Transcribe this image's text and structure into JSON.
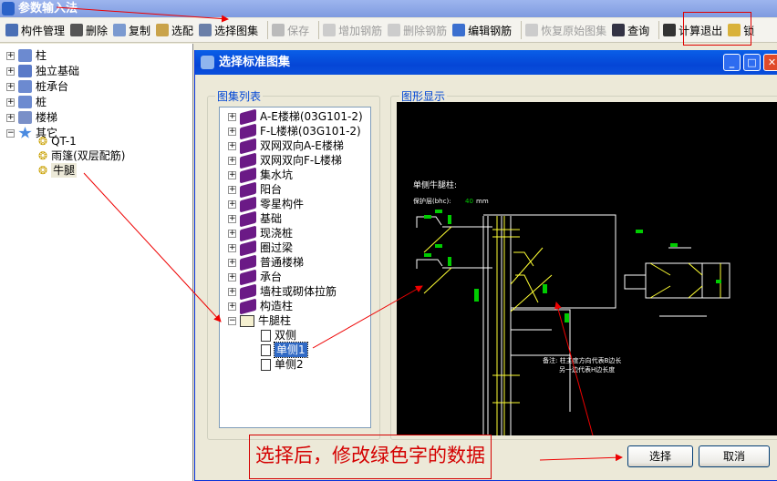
{
  "app": {
    "title": "参数输入法"
  },
  "toolbar": [
    {
      "label": "构件管理",
      "icon": "component-manage-icon",
      "enabled": true
    },
    {
      "label": "删除",
      "icon": "delete-x-icon",
      "enabled": true
    },
    {
      "label": "复制",
      "icon": "copy-icon",
      "enabled": true
    },
    {
      "label": "选配",
      "icon": "clipboard-icon",
      "enabled": true
    },
    {
      "label": "选择图集",
      "icon": "atlas-icon",
      "enabled": true
    },
    {
      "label": "保存",
      "icon": "save-icon",
      "enabled": false
    },
    {
      "label": "增加钢筋",
      "icon": "add-rebar-icon",
      "enabled": false
    },
    {
      "label": "删除钢筋",
      "icon": "remove-rebar-icon",
      "enabled": false
    },
    {
      "label": "编辑钢筋",
      "icon": "edit-rebar-icon",
      "enabled": true
    },
    {
      "label": "恢复原始图集",
      "icon": "restore-icon",
      "enabled": false
    },
    {
      "label": "查询",
      "icon": "binoculars-icon",
      "enabled": true
    },
    {
      "label": "计算退出",
      "icon": "calc-exit-icon",
      "enabled": true
    },
    {
      "label": "锁",
      "icon": "lock-icon",
      "enabled": true
    }
  ],
  "left_tree": {
    "items": [
      {
        "label": "柱",
        "expanded": false
      },
      {
        "label": "独立基础",
        "expanded": false
      },
      {
        "label": "桩承台",
        "expanded": false
      },
      {
        "label": "桩",
        "expanded": false
      },
      {
        "label": "楼梯",
        "expanded": false
      },
      {
        "label": "其它",
        "expanded": true
      }
    ],
    "children": [
      "QT-1",
      "雨篷(双层配筋)",
      "牛腿"
    ],
    "selected": "牛腿"
  },
  "dialog": {
    "title": "选择标准图集",
    "list_group": "图集列表",
    "preview_group": "图形显示",
    "atlas": [
      "A-E楼梯(03G101-2)",
      "F-L楼梯(03G101-2)",
      "双网双向A-E楼梯",
      "双网双向F-L楼梯",
      "集水坑",
      "阳台",
      "零星构件",
      "基础",
      "现浇桩",
      "圈过梁",
      "普通楼梯",
      "承台",
      "墙柱或砌体拉筋",
      "构造柱",
      "牛腿柱"
    ],
    "expanded_children": [
      "双侧",
      "单侧1",
      "单侧2"
    ],
    "selected": "单侧1",
    "select_button": "选择",
    "cancel_button": "取消",
    "drawing": {
      "title": "单侧牛腿柱:",
      "cover_label": "保护层(bhc):",
      "cover_value": "40",
      "cover_unit": "mm",
      "note1": "备注: 柱主度方向代表B边长",
      "note2": "另一边代表H边长度"
    }
  },
  "annotation": {
    "text": "选择后，修改绿色字的数据",
    "color": "#d40000"
  },
  "colors": {
    "cad_bg": "#000000",
    "cad_line_white": "#ffffff",
    "cad_line_yellow": "#ffff33",
    "cad_value_green": "#00c000",
    "title_blue": "#0546d6"
  }
}
